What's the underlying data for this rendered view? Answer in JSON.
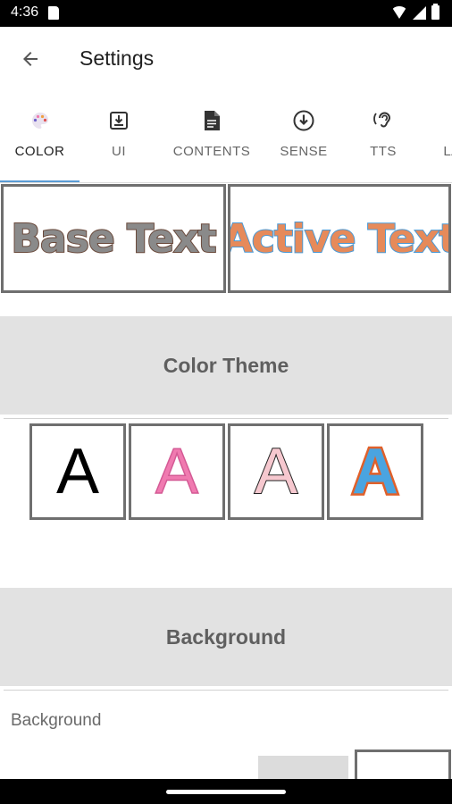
{
  "status_bar": {
    "time": "4:36"
  },
  "app_bar": {
    "title": "Settings"
  },
  "tabs": [
    {
      "label": "COLOR",
      "icon": "palette-icon",
      "active": true
    },
    {
      "label": "UI",
      "icon": "download-box-icon",
      "active": false
    },
    {
      "label": "CONTENTS",
      "icon": "document-icon",
      "active": false
    },
    {
      "label": "SENSE",
      "icon": "arrow-down-circle-icon",
      "active": false
    },
    {
      "label": "TTS",
      "icon": "ear-icon",
      "active": false
    },
    {
      "label": "LA",
      "icon": "",
      "active": false
    }
  ],
  "preview": {
    "base_text": "Base Text",
    "active_text": "Active Text"
  },
  "color_theme": {
    "header": "Color Theme",
    "options": [
      "A",
      "A",
      "A",
      "A"
    ]
  },
  "background": {
    "header": "Background",
    "label": "Background"
  },
  "colors": {
    "tab_indicator": "#5a9bd4",
    "section_header_bg": "#e2e2e2",
    "base_text_fill": "#8a8a8a",
    "base_text_outline": "#6a4a3c",
    "active_text_fill": "#e68a5a",
    "active_text_outline": "#4a9ad6"
  }
}
